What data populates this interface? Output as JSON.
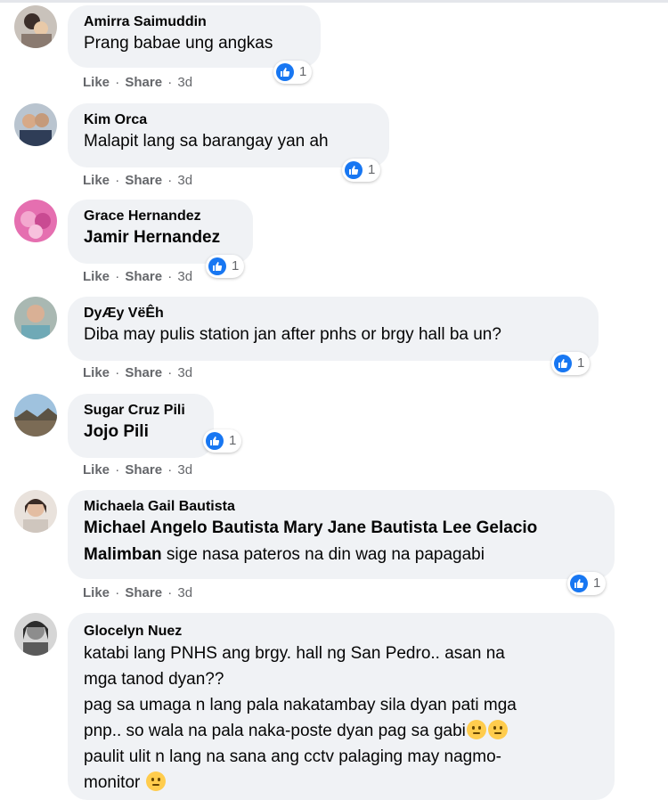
{
  "actions": {
    "like": "Like",
    "share": "Share",
    "separator": "·"
  },
  "colors": {
    "bubble": "#f0f2f5",
    "like_blue": "#1877f2",
    "meta_grey": "#65676b"
  },
  "comments": [
    {
      "author": "Amirra Saimuddin",
      "text": "Prang babae ung angkas",
      "reactions": "1",
      "age": "3d",
      "avatar": "avatar-woman-child"
    },
    {
      "author": "Kim Orca",
      "text": "Malapit lang sa barangay yan ah",
      "reactions": "1",
      "age": "3d",
      "avatar": "avatar-couple"
    },
    {
      "author": "Grace Hernandez",
      "tag": "Jamir Hernandez",
      "text": "",
      "reactions": "1",
      "age": "3d",
      "avatar": "avatar-pink-flowers"
    },
    {
      "author": "DyÆy VëÊh",
      "text": "Diba may pulis station jan after pnhs or brgy hall ba un?",
      "reactions": "1",
      "age": "3d",
      "avatar": "avatar-man-portrait"
    },
    {
      "author": "Sugar Cruz Pili",
      "tag": "Jojo Pili",
      "text": "",
      "reactions": "1",
      "age": "3d",
      "avatar": "avatar-landscape"
    },
    {
      "author": "Michaela Gail Bautista",
      "tag": "Michael Angelo Bautista Mary Jane Bautista Lee Gelacio Malimban",
      "text": " sige nasa pateros na din wag na papagabi",
      "reactions": "1",
      "age": "3d",
      "avatar": "avatar-woman-portrait"
    },
    {
      "author": "Glocelyn Nuez",
      "text_lines": [
        "katabi lang PNHS ang brgy. hall ng San Pedro.. asan na",
        "mga tanod dyan??",
        "pag sa umaga n lang pala nakatambay sila dyan pati mga",
        "pnp.. so wala na pala naka-poste dyan pag sa gabi",
        "paulit ulit n lang na sana ang cctv palaging may nagmo-",
        "monitor"
      ],
      "avatar": "avatar-grey-portrait",
      "emoji": "thinking-face-icon"
    }
  ]
}
